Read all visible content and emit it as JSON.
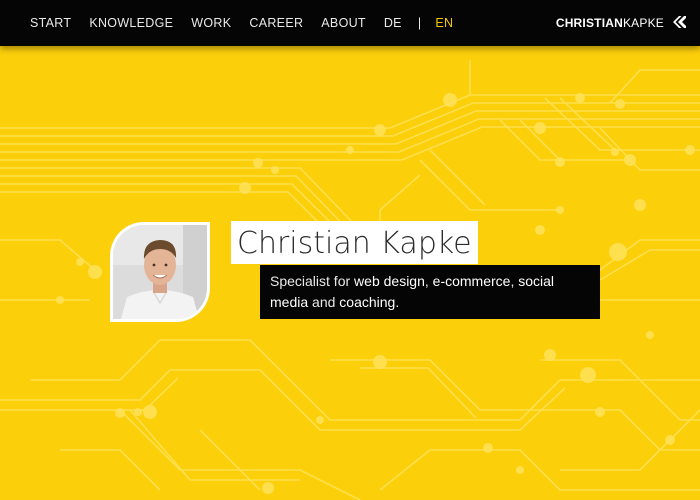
{
  "nav": {
    "items": [
      "START",
      "KNOWLEDGE",
      "WORK",
      "CAREER",
      "ABOUT",
      "DE"
    ],
    "separator": "|",
    "active_lang": "EN"
  },
  "brand": {
    "first": "CHRISTIAN",
    "last": "KAPKE",
    "logo_icon": "ck-logo-icon"
  },
  "hero": {
    "avatar_icon": "portrait-photo",
    "name": "Christian Kapke",
    "tagline": {
      "prefix": "Specialist for ",
      "hl1": "web design",
      "sep1": ", ",
      "hl2": "e-commerce",
      "sep2": ", ",
      "hl3": "social media",
      "sep3": " and ",
      "hl4": "coaching",
      "suffix": "."
    }
  },
  "colors": {
    "background": "#fccf0b",
    "circuit_line": "#ffe25a",
    "topbar": "#050505",
    "active_lang": "#f5c800"
  }
}
